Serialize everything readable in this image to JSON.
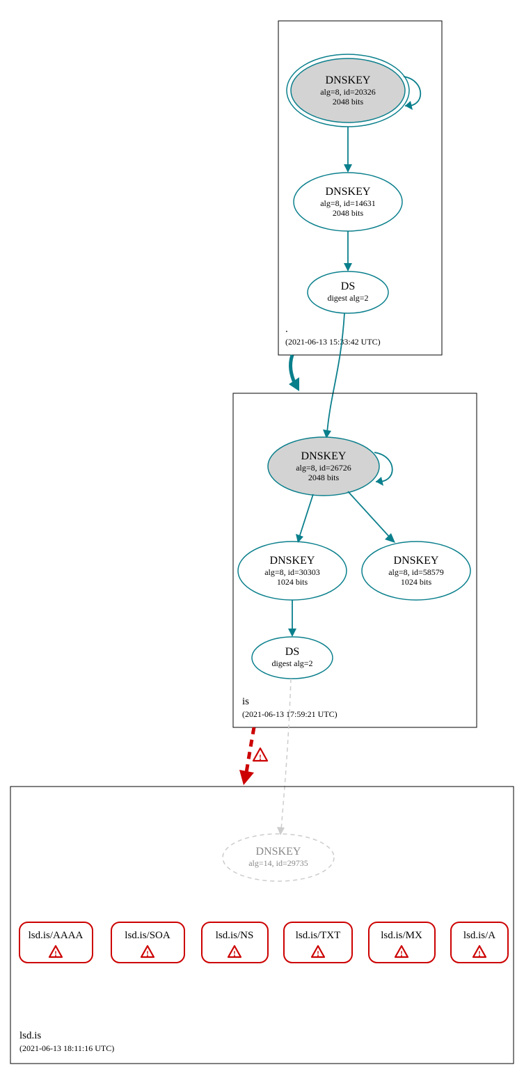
{
  "colors": {
    "teal": "#0a7f8c",
    "red": "#cc0000",
    "node_grey_fill": "#d3d3d3",
    "dash_grey": "#cccccc"
  },
  "zones": {
    "root": {
      "label": ".",
      "timestamp": "(2021-06-13 15:33:42 UTC)",
      "nodes": {
        "ksk": {
          "title": "DNSKEY",
          "line1": "alg=8, id=20326",
          "line2": "2048 bits"
        },
        "zsk": {
          "title": "DNSKEY",
          "line1": "alg=8, id=14631",
          "line2": "2048 bits"
        },
        "ds": {
          "title": "DS",
          "line1": "digest alg=2"
        }
      }
    },
    "is": {
      "label": "is",
      "timestamp": "(2021-06-13 17:59:21 UTC)",
      "nodes": {
        "ksk": {
          "title": "DNSKEY",
          "line1": "alg=8, id=26726",
          "line2": "2048 bits"
        },
        "zsk1": {
          "title": "DNSKEY",
          "line1": "alg=8, id=30303",
          "line2": "1024 bits"
        },
        "zsk2": {
          "title": "DNSKEY",
          "line1": "alg=8, id=58579",
          "line2": "1024 bits"
        },
        "ds": {
          "title": "DS",
          "line1": "digest alg=2"
        }
      }
    },
    "lsd_is": {
      "label": "lsd.is",
      "timestamp": "(2021-06-13 18:11:16 UTC)",
      "nodes": {
        "dnskey": {
          "title": "DNSKEY",
          "line1": "alg=14, id=29735"
        }
      },
      "rrsets": [
        {
          "label": "lsd.is/AAAA"
        },
        {
          "label": "lsd.is/SOA"
        },
        {
          "label": "lsd.is/NS"
        },
        {
          "label": "lsd.is/TXT"
        },
        {
          "label": "lsd.is/MX"
        },
        {
          "label": "lsd.is/A"
        }
      ]
    }
  }
}
